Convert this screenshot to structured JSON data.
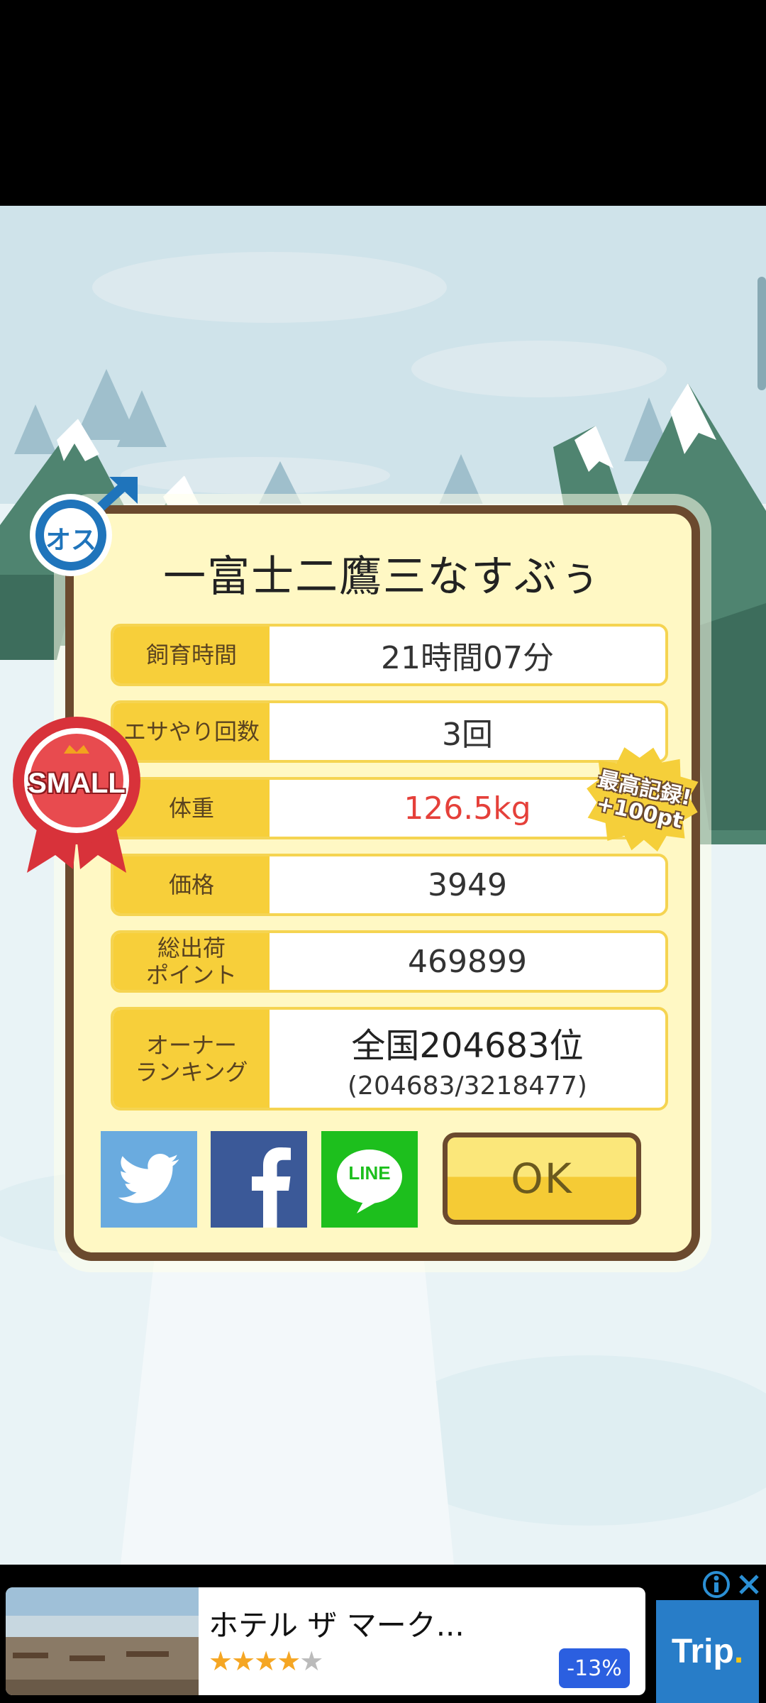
{
  "result": {
    "pig_name": "一富士二鷹三なすぶぅ",
    "gender_badge": "オス",
    "size_ribbon": "SMALL",
    "record_badge_line1": "最高記録!",
    "record_badge_line2": "+100pt",
    "rows": [
      {
        "label": "飼育時間",
        "value": "21時間07分"
      },
      {
        "label": "エサやり回数",
        "value": "3回"
      },
      {
        "label": "体重",
        "value": "126.5kg"
      },
      {
        "label": "価格",
        "value": "3949"
      },
      {
        "label_line1": "総出荷",
        "label_line2": "ポイント",
        "value": "469899"
      }
    ],
    "ranking": {
      "label_line1": "オーナー",
      "label_line2": "ランキング",
      "value_main": "全国204683位",
      "value_sub": "(204683/3218477)"
    },
    "share": {
      "line_label": "LINE"
    },
    "ok_label": "OK"
  },
  "ad": {
    "title": "ホテル ザ マーク...",
    "stars_filled": "★★★★",
    "stars_empty": "★",
    "rating": 4,
    "discount": "-13%",
    "brand": "Trip",
    "brand_dot": "."
  },
  "colors": {
    "dialog_bg": "#fff8c4",
    "dialog_border": "#6b4a2e",
    "label_bg": "#f7cf3a",
    "weight_value": "#e5403a",
    "twitter": "#6aabdf",
    "facebook": "#3b5998",
    "line": "#1dbf1d"
  }
}
